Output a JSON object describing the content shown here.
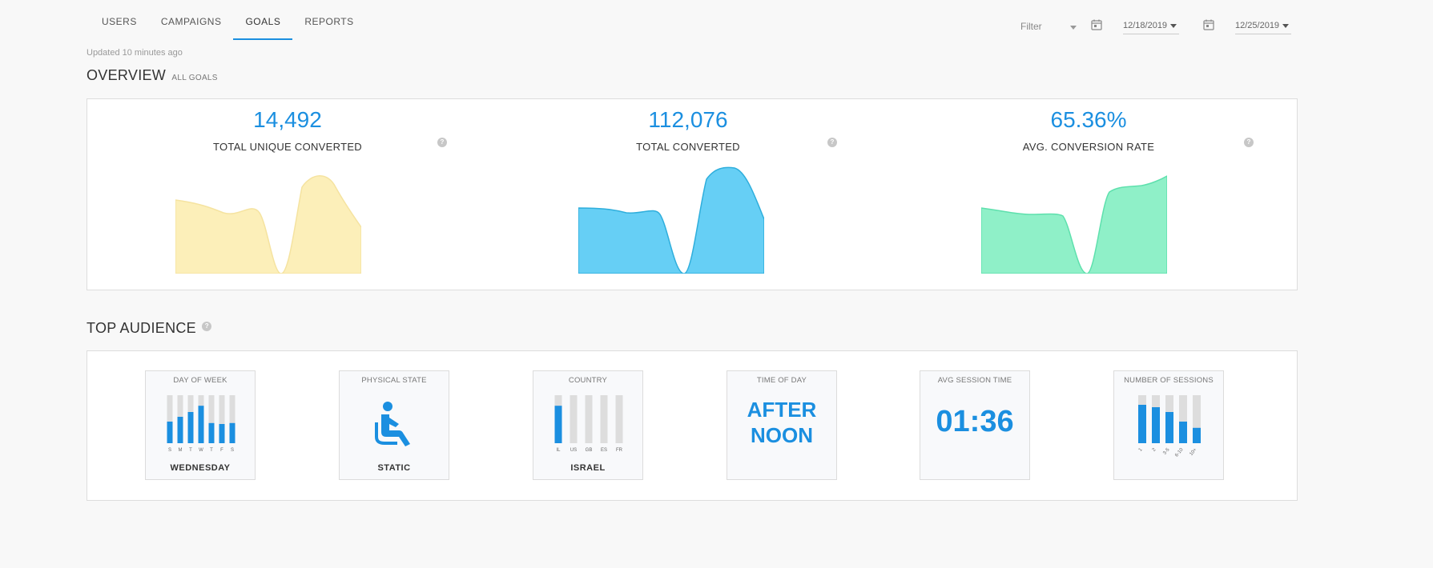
{
  "nav": {
    "tabs": [
      {
        "label": "USERS"
      },
      {
        "label": "CAMPAIGNS"
      },
      {
        "label": "GOALS",
        "active": true
      },
      {
        "label": "REPORTS"
      }
    ]
  },
  "filters": {
    "filter_placeholder": "Filter",
    "start_date": "12/18/2019",
    "end_date": "12/25/2019"
  },
  "updated_text": "Updated 10 minutes ago",
  "overview": {
    "title": "OVERVIEW",
    "subtitle": "ALL GOALS",
    "kpis": [
      {
        "value": "14,492",
        "label": "TOTAL UNIQUE CONVERTED",
        "color": "#fcefb9",
        "stroke": "#f5e3a0"
      },
      {
        "value": "112,076",
        "label": "TOTAL CONVERTED",
        "color": "#66cff5",
        "stroke": "#2eaedc"
      },
      {
        "value": "65.36%",
        "label": "AVG. CONVERSION RATE",
        "color": "#8ff0c8",
        "stroke": "#5ee0ad"
      }
    ]
  },
  "top_audience": {
    "title": "TOP AUDIENCE",
    "cards": [
      {
        "title": "DAY OF WEEK",
        "value": "WEDNESDAY",
        "bar_labels": [
          "S",
          "M",
          "T",
          "W",
          "T",
          "F",
          "S"
        ],
        "bar_levels": [
          0.45,
          0.55,
          0.65,
          0.78,
          0.42,
          0.4,
          0.42
        ]
      },
      {
        "title": "PHYSICAL STATE",
        "value": "STATIC",
        "icon": "seated-person-icon"
      },
      {
        "title": "COUNTRY",
        "value": "ISRAEL",
        "bar_labels": [
          "IL",
          "US",
          "GB",
          "ES",
          "FR"
        ],
        "bar_levels": [
          0.78,
          0,
          0,
          0,
          0
        ]
      },
      {
        "title": "TIME OF DAY",
        "line1": "AFTER",
        "line2": "NOON"
      },
      {
        "title": "AVG SESSION TIME",
        "big": "01:36"
      },
      {
        "title": "NUMBER OF SESSIONS",
        "bar_labels": [
          "1",
          "2",
          "3-5",
          "6-10",
          "10+"
        ],
        "bar_levels": [
          0.8,
          0.75,
          0.65,
          0.45,
          0.32
        ]
      }
    ]
  },
  "colors": {
    "accent": "#1b8fe0",
    "bar_bg": "#dddddd"
  }
}
